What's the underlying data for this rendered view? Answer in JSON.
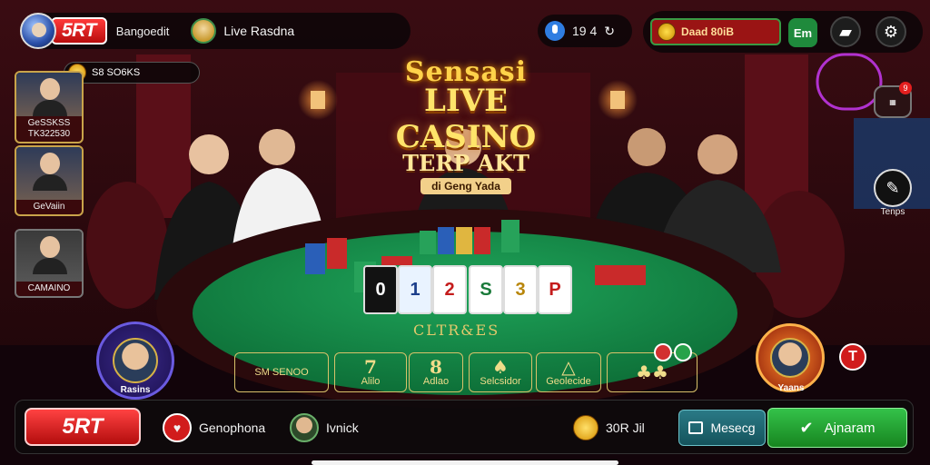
{
  "colors": {
    "felt": "#15894a",
    "accent_red": "#d61a1a",
    "gold": "#ffd24a",
    "join_green": "#23a236",
    "message_teal": "#1f6b75"
  },
  "header": {
    "brand": "5RT",
    "username": "Bangoedit",
    "room_name": "Live Rasdna",
    "stats": "19 4",
    "balance": "Daad 80iB",
    "em_button": "Em",
    "icons": [
      "profile-icon",
      "coin-icon",
      "mic-icon",
      "wallet-icon",
      "settings-icon"
    ]
  },
  "sidebar": {
    "coin_badge": "S8 SO6KS",
    "players": [
      {
        "label": "GeSSKSS\nTK322530"
      },
      {
        "label": "GeVaiin"
      },
      {
        "label": "CAMAINO"
      }
    ]
  },
  "title": {
    "line1": "Sensasi",
    "line2": "LIVE CASINO",
    "line3": "TERP AKT",
    "tag": "di Geng Yada"
  },
  "right_panel": {
    "notification_count": "9",
    "tips_label": "Tenps"
  },
  "table": {
    "title": "CLTR&ES",
    "cards": [
      "0",
      "1",
      "2",
      "S",
      "3",
      "P"
    ],
    "zones": [
      {
        "big": "",
        "small": "SM SENOO"
      },
      {
        "big": "7",
        "small": "Alilo"
      },
      {
        "big": "8",
        "small": "Adlao"
      },
      {
        "big": "♠",
        "small": "Selcsidor"
      },
      {
        "big": "△",
        "small": "Geolecide"
      },
      {
        "big": "♣♣",
        "small": ""
      }
    ],
    "left_avatar_label": "Rasins",
    "right_avatar_label": "Yaans"
  },
  "bottombar": {
    "brand": "5RT",
    "item1": "Genophona",
    "item2": "Ivnick",
    "balance": "30R Jil",
    "message": "Mesecg",
    "join": "Ajnaram"
  }
}
